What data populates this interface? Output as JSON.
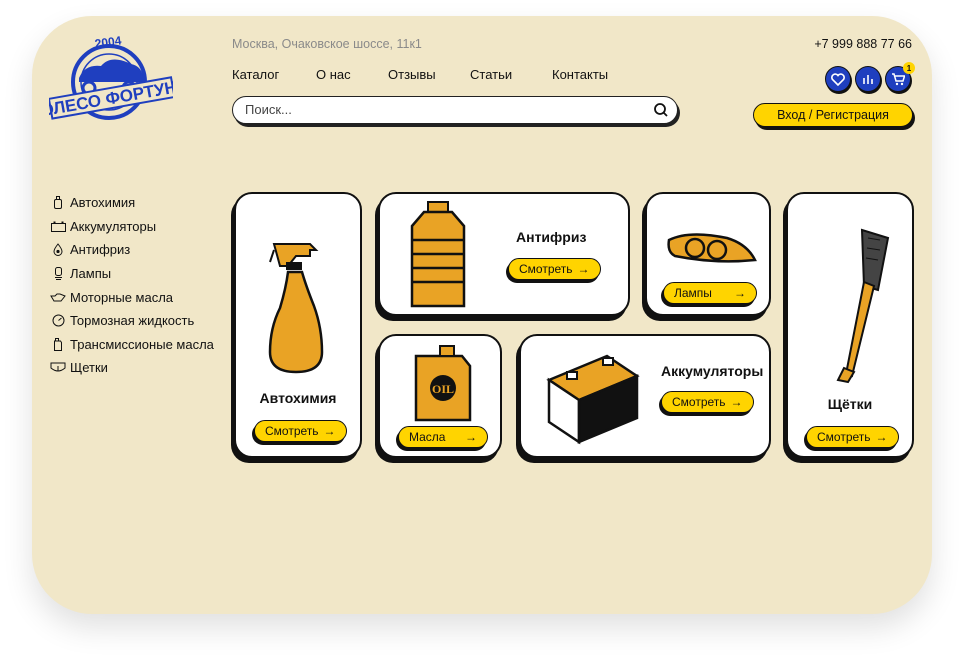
{
  "header": {
    "address": "Москва, Очаковское шоссе, 11к1",
    "phone": "+7 999 888 77 66",
    "logo_text": "КОЛЕСО ФОРТУНЫ",
    "logo_year": "2004"
  },
  "nav": [
    "Каталог",
    "О нас",
    "Отзывы",
    "Статьи",
    "Контакты"
  ],
  "search": {
    "placeholder": "Поиск...",
    "icon": "search-icon"
  },
  "actions": {
    "favorites_icon": "heart-icon",
    "compare_icon": "chart-icon",
    "cart_icon": "cart-icon",
    "cart_count": "1",
    "login_label": "Вход / Регистрация"
  },
  "sidebar": [
    {
      "label": "Автохимия",
      "icon": "bottle-icon"
    },
    {
      "label": "Аккумуляторы",
      "icon": "battery-icon"
    },
    {
      "label": "Антифриз",
      "icon": "drop-icon"
    },
    {
      "label": "Лампы",
      "icon": "lamp-icon"
    },
    {
      "label": "Моторные масла",
      "icon": "oilcan-icon"
    },
    {
      "label": "Тормозная жидкость",
      "icon": "gauge-icon"
    },
    {
      "label": "Трансмиссионые масла",
      "icon": "canister-icon"
    },
    {
      "label": "Щетки",
      "icon": "wiper-icon"
    }
  ],
  "cards": {
    "autochem": {
      "title": "Автохимия",
      "button": "Смотреть",
      "arrow": "→"
    },
    "antifreeze": {
      "title": "Антифриз",
      "button": "Смотреть",
      "arrow": "→"
    },
    "lamps": {
      "button": "Лампы",
      "arrow": "→"
    },
    "brushes": {
      "title": "Щётки",
      "button": "Смотреть",
      "arrow": "→"
    },
    "oils": {
      "button": "Масла",
      "arrow": "→",
      "label": "OIL"
    },
    "batteries": {
      "title": "Аккумуляторы",
      "button": "Смотреть",
      "arrow": "→"
    }
  },
  "colors": {
    "background": "#f1e7c8",
    "accent": "#ffd400",
    "brand": "#1f3fbf",
    "product": "#e9a325"
  }
}
